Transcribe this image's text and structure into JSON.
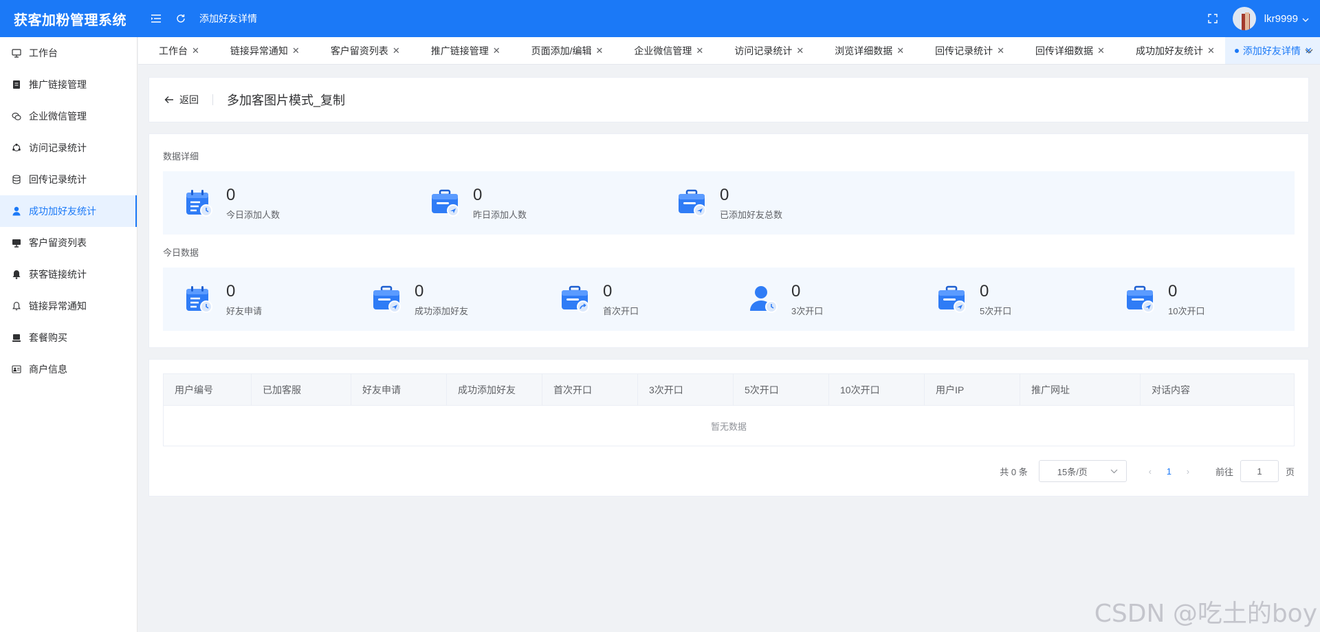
{
  "header": {
    "app_title": "获客加粉管理系统",
    "page_title": "添加好友详情",
    "username": "lkr9999"
  },
  "sidebar": {
    "items": [
      {
        "label": "工作台",
        "icon": "monitor-icon"
      },
      {
        "label": "推广链接管理",
        "icon": "document-icon"
      },
      {
        "label": "企业微信管理",
        "icon": "chat-icon"
      },
      {
        "label": "访问记录统计",
        "icon": "share-icon"
      },
      {
        "label": "回传记录统计",
        "icon": "database-icon"
      },
      {
        "label": "成功加好友统计",
        "icon": "user-icon",
        "active": true
      },
      {
        "label": "客户留资列表",
        "icon": "desktop-icon"
      },
      {
        "label": "获客链接统计",
        "icon": "bell-icon"
      },
      {
        "label": "链接异常通知",
        "icon": "bell-outline-icon"
      },
      {
        "label": "套餐购买",
        "icon": "monitor-filled-icon"
      },
      {
        "label": "商户信息",
        "icon": "id-card-icon"
      }
    ]
  },
  "tabs": [
    {
      "label": "工作台"
    },
    {
      "label": "链接异常通知"
    },
    {
      "label": "客户留资列表"
    },
    {
      "label": "推广链接管理"
    },
    {
      "label": "页面添加/编辑"
    },
    {
      "label": "企业微信管理"
    },
    {
      "label": "访问记录统计"
    },
    {
      "label": "浏览详细数据"
    },
    {
      "label": "回传记录统计"
    },
    {
      "label": "回传详细数据"
    },
    {
      "label": "成功加好友统计"
    },
    {
      "label": "添加好友详情",
      "active": true
    }
  ],
  "title_card": {
    "back_label": "返回",
    "title": "多加客图片模式_复制"
  },
  "data_detail": {
    "section_label": "数据详细",
    "stats": [
      {
        "value": "0",
        "label": "今日添加人数",
        "icon": "calendar-clock-icon"
      },
      {
        "value": "0",
        "label": "昨日添加人数",
        "icon": "briefcase-plane-icon"
      },
      {
        "value": "0",
        "label": "已添加好友总数",
        "icon": "briefcase-plane-icon"
      }
    ]
  },
  "today_data": {
    "section_label": "今日数据",
    "stats": [
      {
        "value": "0",
        "label": "好友申请",
        "icon": "calendar-clock-icon"
      },
      {
        "value": "0",
        "label": "成功添加好友",
        "icon": "briefcase-plane-icon"
      },
      {
        "value": "0",
        "label": "首次开口",
        "icon": "briefcase-share-icon"
      },
      {
        "value": "0",
        "label": "3次开口",
        "icon": "user-clock-icon"
      },
      {
        "value": "0",
        "label": "5次开口",
        "icon": "briefcase-plane-icon"
      },
      {
        "value": "0",
        "label": "10次开口",
        "icon": "briefcase-plane-icon"
      }
    ]
  },
  "table": {
    "columns": [
      "用户编号",
      "已加客服",
      "好友申请",
      "成功添加好友",
      "首次开口",
      "3次开口",
      "5次开口",
      "10次开口",
      "用户IP",
      "推广网址",
      "对话内容"
    ],
    "empty_text": "暂无数据"
  },
  "pagination": {
    "total_text": "共 0 条",
    "page_size": "15条/页",
    "current_page": "1",
    "goto_label": "前往",
    "goto_value": "1",
    "page_suffix": "页"
  },
  "watermark": "CSDN @吃土的boy"
}
